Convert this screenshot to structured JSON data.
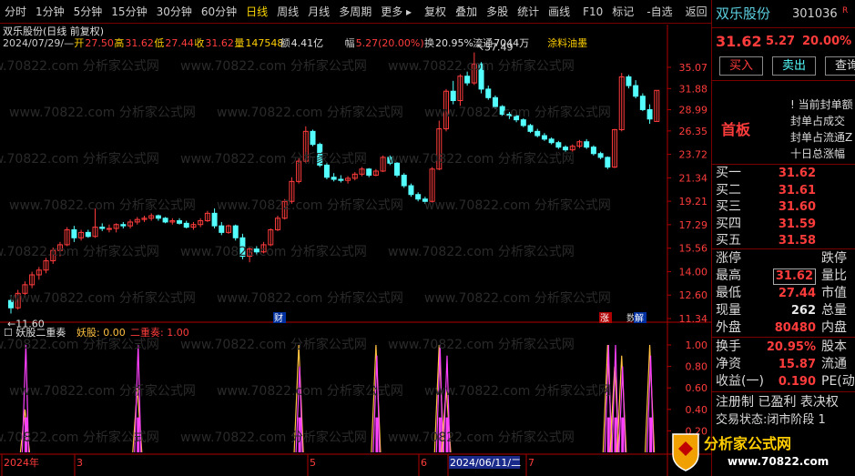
{
  "toolbar": {
    "items": [
      {
        "label": "分时"
      },
      {
        "label": "1分钟"
      },
      {
        "label": "5分钟"
      },
      {
        "label": "15分钟"
      },
      {
        "label": "30分钟"
      },
      {
        "label": "60分钟"
      },
      {
        "label": "日线",
        "active": true
      },
      {
        "label": "周线"
      },
      {
        "label": "月线"
      },
      {
        "label": "多周期"
      },
      {
        "label": "更多 ▸"
      },
      {
        "label": "复权"
      },
      {
        "label": "叠加"
      },
      {
        "label": "多股"
      },
      {
        "label": "统计"
      },
      {
        "label": "画线"
      },
      {
        "label": "F10"
      },
      {
        "label": "标记"
      },
      {
        "label": "-自选"
      },
      {
        "label": "返回"
      }
    ]
  },
  "chart_header": {
    "title": "双乐股份(日线 前复权)",
    "info_date": "2024/07/29/—",
    "open_label": "开",
    "open": "27.50",
    "high_label": "高",
    "high": "31.62",
    "low_label": "低",
    "low": "27.44",
    "close_label": "收",
    "close": "31.62",
    "vol_label": "量",
    "vol": "147548",
    "amt_label": "额",
    "amt": "4.41亿",
    "chg_label": "幅",
    "chg": "5.27(20.00%)",
    "turn_label": "换",
    "turn": "20.95%",
    "float_label": "流通",
    "float": "7044万",
    "concept": "涂料油墨"
  },
  "indicator": {
    "name": "妖股二重奏",
    "s1_label": "妖股:",
    "s1_value": "0.00",
    "s2_label": "二重奏:",
    "s2_value": "1.00"
  },
  "price_axis": [
    "35.07",
    "31.88",
    "28.99",
    "26.35",
    "23.72",
    "21.34",
    "19.21",
    "17.29",
    "15.56",
    "14.00",
    "12.60",
    "11.34"
  ],
  "ind_axis": [
    "1.00",
    "0.80",
    "0.60",
    "0.40",
    "0.20"
  ],
  "annotations": {
    "high": "37.49",
    "low": "11.60",
    "cai": "财",
    "zhang": "涨",
    "jie": "解",
    "jie_prefix": "数"
  },
  "time_axis": [
    {
      "label": "2024年"
    },
    {
      "label": "3"
    },
    {
      "label": "5"
    },
    {
      "label": "6"
    },
    {
      "label": "2024/06/11/二",
      "highlight": true
    },
    {
      "label": "7"
    }
  ],
  "watermark_text": "www.70822.com 分析家公式网",
  "colors": {
    "up": "#ff3c3c",
    "down": "#54ffff",
    "axis": "#b00000",
    "s1": "#ffc040",
    "s2": "#ff40ff"
  },
  "chart_data": {
    "type": "candlestick",
    "ohlc": [
      [
        12.3,
        12.6,
        11.6,
        11.9
      ],
      [
        11.9,
        12.9,
        11.8,
        12.7
      ],
      [
        12.7,
        13.4,
        12.5,
        13.2
      ],
      [
        13.2,
        14.0,
        13.0,
        13.8
      ],
      [
        13.8,
        14.3,
        13.5,
        14.1
      ],
      [
        14.1,
        14.9,
        13.9,
        14.7
      ],
      [
        14.7,
        15.6,
        14.5,
        15.4
      ],
      [
        15.4,
        16.0,
        15.0,
        15.8
      ],
      [
        15.8,
        17.1,
        15.7,
        16.9
      ],
      [
        16.9,
        17.2,
        16.0,
        16.3
      ],
      [
        16.3,
        16.9,
        16.1,
        16.7
      ],
      [
        16.7,
        16.9,
        16.3,
        16.4
      ],
      [
        16.4,
        18.6,
        16.3,
        17.1
      ],
      [
        17.1,
        17.4,
        16.8,
        17.0
      ],
      [
        17.0,
        17.3,
        16.7,
        17.0
      ],
      [
        17.0,
        17.4,
        16.7,
        17.3
      ],
      [
        17.3,
        17.5,
        17.0,
        17.2
      ],
      [
        17.2,
        17.7,
        17.0,
        17.5
      ],
      [
        17.5,
        17.9,
        17.3,
        17.7
      ],
      [
        17.7,
        18.0,
        17.5,
        17.8
      ],
      [
        17.8,
        18.2,
        17.6,
        18.0
      ],
      [
        18.0,
        18.1,
        17.6,
        17.8
      ],
      [
        17.8,
        17.9,
        17.4,
        17.5
      ],
      [
        17.5,
        17.8,
        17.3,
        17.6
      ],
      [
        17.6,
        17.8,
        17.3,
        17.4
      ],
      [
        17.4,
        17.6,
        17.0,
        17.1
      ],
      [
        17.1,
        17.5,
        16.9,
        17.3
      ],
      [
        17.3,
        17.8,
        17.1,
        17.6
      ],
      [
        17.6,
        18.4,
        17.5,
        18.2
      ],
      [
        18.2,
        18.6,
        17.0,
        17.2
      ],
      [
        17.2,
        17.5,
        16.5,
        16.7
      ],
      [
        16.7,
        17.3,
        16.6,
        17.2
      ],
      [
        17.2,
        17.3,
        16.1,
        16.3
      ],
      [
        16.3,
        16.6,
        14.8,
        15.0
      ],
      [
        15.0,
        15.6,
        14.6,
        15.5
      ],
      [
        15.5,
        15.7,
        15.1,
        15.3
      ],
      [
        15.3,
        16.0,
        15.2,
        15.8
      ],
      [
        15.8,
        17.0,
        15.7,
        16.9
      ],
      [
        16.9,
        18.0,
        16.8,
        17.8
      ],
      [
        17.8,
        19.4,
        17.7,
        19.2
      ],
      [
        19.2,
        21.4,
        19.0,
        21.0
      ],
      [
        21.0,
        23.3,
        20.8,
        23.0
      ],
      [
        23.0,
        26.9,
        22.8,
        26.3
      ],
      [
        26.3,
        26.5,
        24.6,
        24.8
      ],
      [
        24.8,
        25.0,
        22.4,
        22.6
      ],
      [
        22.6,
        22.8,
        21.2,
        21.4
      ],
      [
        21.4,
        21.8,
        21.0,
        21.2
      ],
      [
        21.2,
        21.6,
        20.9,
        21.1
      ],
      [
        21.1,
        21.5,
        20.8,
        21.3
      ],
      [
        21.3,
        21.9,
        21.1,
        21.7
      ],
      [
        21.7,
        22.4,
        21.5,
        22.2
      ],
      [
        22.2,
        22.3,
        21.4,
        21.6
      ],
      [
        21.6,
        22.2,
        21.5,
        22.0
      ],
      [
        22.0,
        23.6,
        21.9,
        23.4
      ],
      [
        23.4,
        23.6,
        22.6,
        22.8
      ],
      [
        22.8,
        22.9,
        21.4,
        21.6
      ],
      [
        21.6,
        21.8,
        20.4,
        20.6
      ],
      [
        20.6,
        20.8,
        19.6,
        19.8
      ],
      [
        19.8,
        20.0,
        19.2,
        19.4
      ],
      [
        19.4,
        19.6,
        19.0,
        19.2
      ],
      [
        19.2,
        22.4,
        19.1,
        22.2
      ],
      [
        22.2,
        27.6,
        22.1,
        26.6
      ],
      [
        26.6,
        31.8,
        26.3,
        31.5
      ],
      [
        31.5,
        33.0,
        29.7,
        30.2
      ],
      [
        30.2,
        34.0,
        29.5,
        33.7
      ],
      [
        33.7,
        34.4,
        32.3,
        32.7
      ],
      [
        32.7,
        37.49,
        32.4,
        35.6
      ],
      [
        35.6,
        35.9,
        31.2,
        31.8
      ],
      [
        31.8,
        32.3,
        30.3,
        30.6
      ],
      [
        30.6,
        30.9,
        29.1,
        29.4
      ],
      [
        29.4,
        29.6,
        28.2,
        28.4
      ],
      [
        28.4,
        28.7,
        27.8,
        28.2
      ],
      [
        28.2,
        28.4,
        27.4,
        27.7
      ],
      [
        27.7,
        27.9,
        26.8,
        27.0
      ],
      [
        27.0,
        27.2,
        26.1,
        26.3
      ],
      [
        26.3,
        26.6,
        25.6,
        25.8
      ],
      [
        25.8,
        26.1,
        25.2,
        25.4
      ],
      [
        25.4,
        25.6,
        24.8,
        25.0
      ],
      [
        25.0,
        25.2,
        24.3,
        24.5
      ],
      [
        24.5,
        24.7,
        24.0,
        24.2
      ],
      [
        24.2,
        24.8,
        24.0,
        24.6
      ],
      [
        24.6,
        25.3,
        24.4,
        25.1
      ],
      [
        25.1,
        25.4,
        24.3,
        24.5
      ],
      [
        24.5,
        24.7,
        23.6,
        23.8
      ],
      [
        23.8,
        24.0,
        23.2,
        23.4
      ],
      [
        23.4,
        23.5,
        22.2,
        22.4
      ],
      [
        22.4,
        26.6,
        22.3,
        26.5
      ],
      [
        26.5,
        34.2,
        26.3,
        33.6
      ],
      [
        33.6,
        33.9,
        31.9,
        32.3
      ],
      [
        32.3,
        33.1,
        30.5,
        30.8
      ],
      [
        30.8,
        31.2,
        28.8,
        29.0
      ],
      [
        29.0,
        29.7,
        27.2,
        27.8
      ],
      [
        27.5,
        31.62,
        27.44,
        31.62
      ]
    ],
    "signals": [
      {
        "x": 2,
        "s1": 0.4,
        "s2": 1
      },
      {
        "x": 18,
        "s1": 0.6,
        "s2": 1
      },
      {
        "x": 41,
        "s1": 1,
        "s2": 0.8
      },
      {
        "x": 52,
        "s1": 1,
        "s2": 0.9
      },
      {
        "x": 61,
        "s1": 1,
        "s2": 1
      },
      {
        "x": 62,
        "s1": 0.6,
        "s2": 0.9
      },
      {
        "x": 85,
        "s1": 1,
        "s2": 1
      },
      {
        "x": 86,
        "s1": 0.8,
        "s2": 1
      },
      {
        "x": 87,
        "s1": 0.9,
        "s2": 0.8
      },
      {
        "x": 91,
        "s1": 1,
        "s2": 0.9
      }
    ]
  },
  "quote": {
    "name": "双乐股份",
    "code": "301036",
    "code_suffix": "R",
    "price": "31.62",
    "change": "5.27",
    "pct": "20.00%",
    "buy_btn": "买入",
    "sell_btn": "卖出",
    "query_btn": "查询",
    "board": "首板",
    "board_lines": [
      "当前封单额",
      "封单占成交",
      "封单占流通Z",
      "十日总涨幅"
    ],
    "bids": [
      {
        "label": "买一",
        "val": "31.62"
      },
      {
        "label": "买二",
        "val": "31.61"
      },
      {
        "label": "买三",
        "val": "31.60"
      },
      {
        "label": "买四",
        "val": "31.59"
      },
      {
        "label": "买五",
        "val": "31.58"
      }
    ],
    "stats": [
      {
        "label": "涨停",
        "val": "",
        "right": "跌停"
      },
      {
        "label": "最高",
        "val": "31.62",
        "right": "量比",
        "boxed": true
      },
      {
        "label": "最低",
        "val": "27.44",
        "right": "市值"
      },
      {
        "label": "现量",
        "val": "262",
        "right": "总量",
        "color": "white"
      },
      {
        "label": "外盘",
        "val": "80480",
        "right": "内盘"
      }
    ],
    "fin": [
      {
        "label": "换手",
        "val": "20.95%",
        "right": "股本"
      },
      {
        "label": "净资",
        "val": "15.87",
        "right": "流通"
      },
      {
        "label": "收益(一)",
        "val": "0.190",
        "right": "PE(动"
      }
    ],
    "footer1": "注册制 已盈利 表决权",
    "footer2": "交易状态:闭市阶段 1",
    "logo_text": "分析家公式网",
    "logo_url": "www.70822.com"
  }
}
